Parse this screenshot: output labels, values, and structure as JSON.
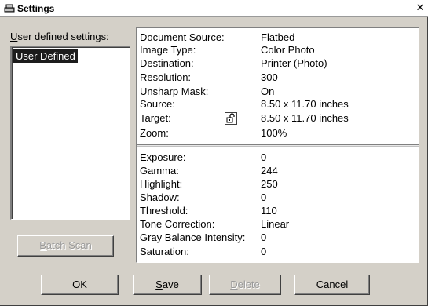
{
  "window": {
    "title": "Settings",
    "close_glyph": "✕",
    "title_icon": "scanner-icon"
  },
  "left": {
    "label_mnemonic": "U",
    "label_rest": "ser defined settings:",
    "list_items": [
      "User Defined"
    ],
    "batch_scan_mnemonic": "B",
    "batch_scan_rest": "atch Scan"
  },
  "settings_top": [
    {
      "label": "Document Source:",
      "value": "Flatbed"
    },
    {
      "label": "Image Type:",
      "value": "Color Photo"
    },
    {
      "label": "Destination:",
      "value": "Printer (Photo)"
    },
    {
      "label": "Resolution:",
      "value": "300"
    },
    {
      "label": "Unsharp Mask:",
      "value": "On"
    },
    {
      "label": "Source:",
      "value": "8.50 x 11.70 inches"
    },
    {
      "label": "Target:",
      "value": "8.50 x 11.70 inches"
    },
    {
      "label": "Zoom:",
      "value": "100%"
    }
  ],
  "settings_bottom": [
    {
      "label": "Exposure:",
      "value": "0"
    },
    {
      "label": "Gamma:",
      "value": "244"
    },
    {
      "label": "Highlight:",
      "value": "250"
    },
    {
      "label": "Shadow:",
      "value": "0"
    },
    {
      "label": "Threshold:",
      "value": "110"
    },
    {
      "label": "Tone Correction:",
      "value": "Linear"
    },
    {
      "label": "Gray Balance Intensity:",
      "value": "0"
    },
    {
      "label": "Saturation:",
      "value": "0"
    }
  ],
  "buttons": {
    "ok": "OK",
    "save_mnemonic": "S",
    "save_rest": "ave",
    "delete_mnemonic": "D",
    "delete_rest": "elete",
    "cancel": "Cancel"
  },
  "colors": {
    "dialog_bg": "#d4d0c8",
    "selection_bg": "#1c1c1c"
  }
}
